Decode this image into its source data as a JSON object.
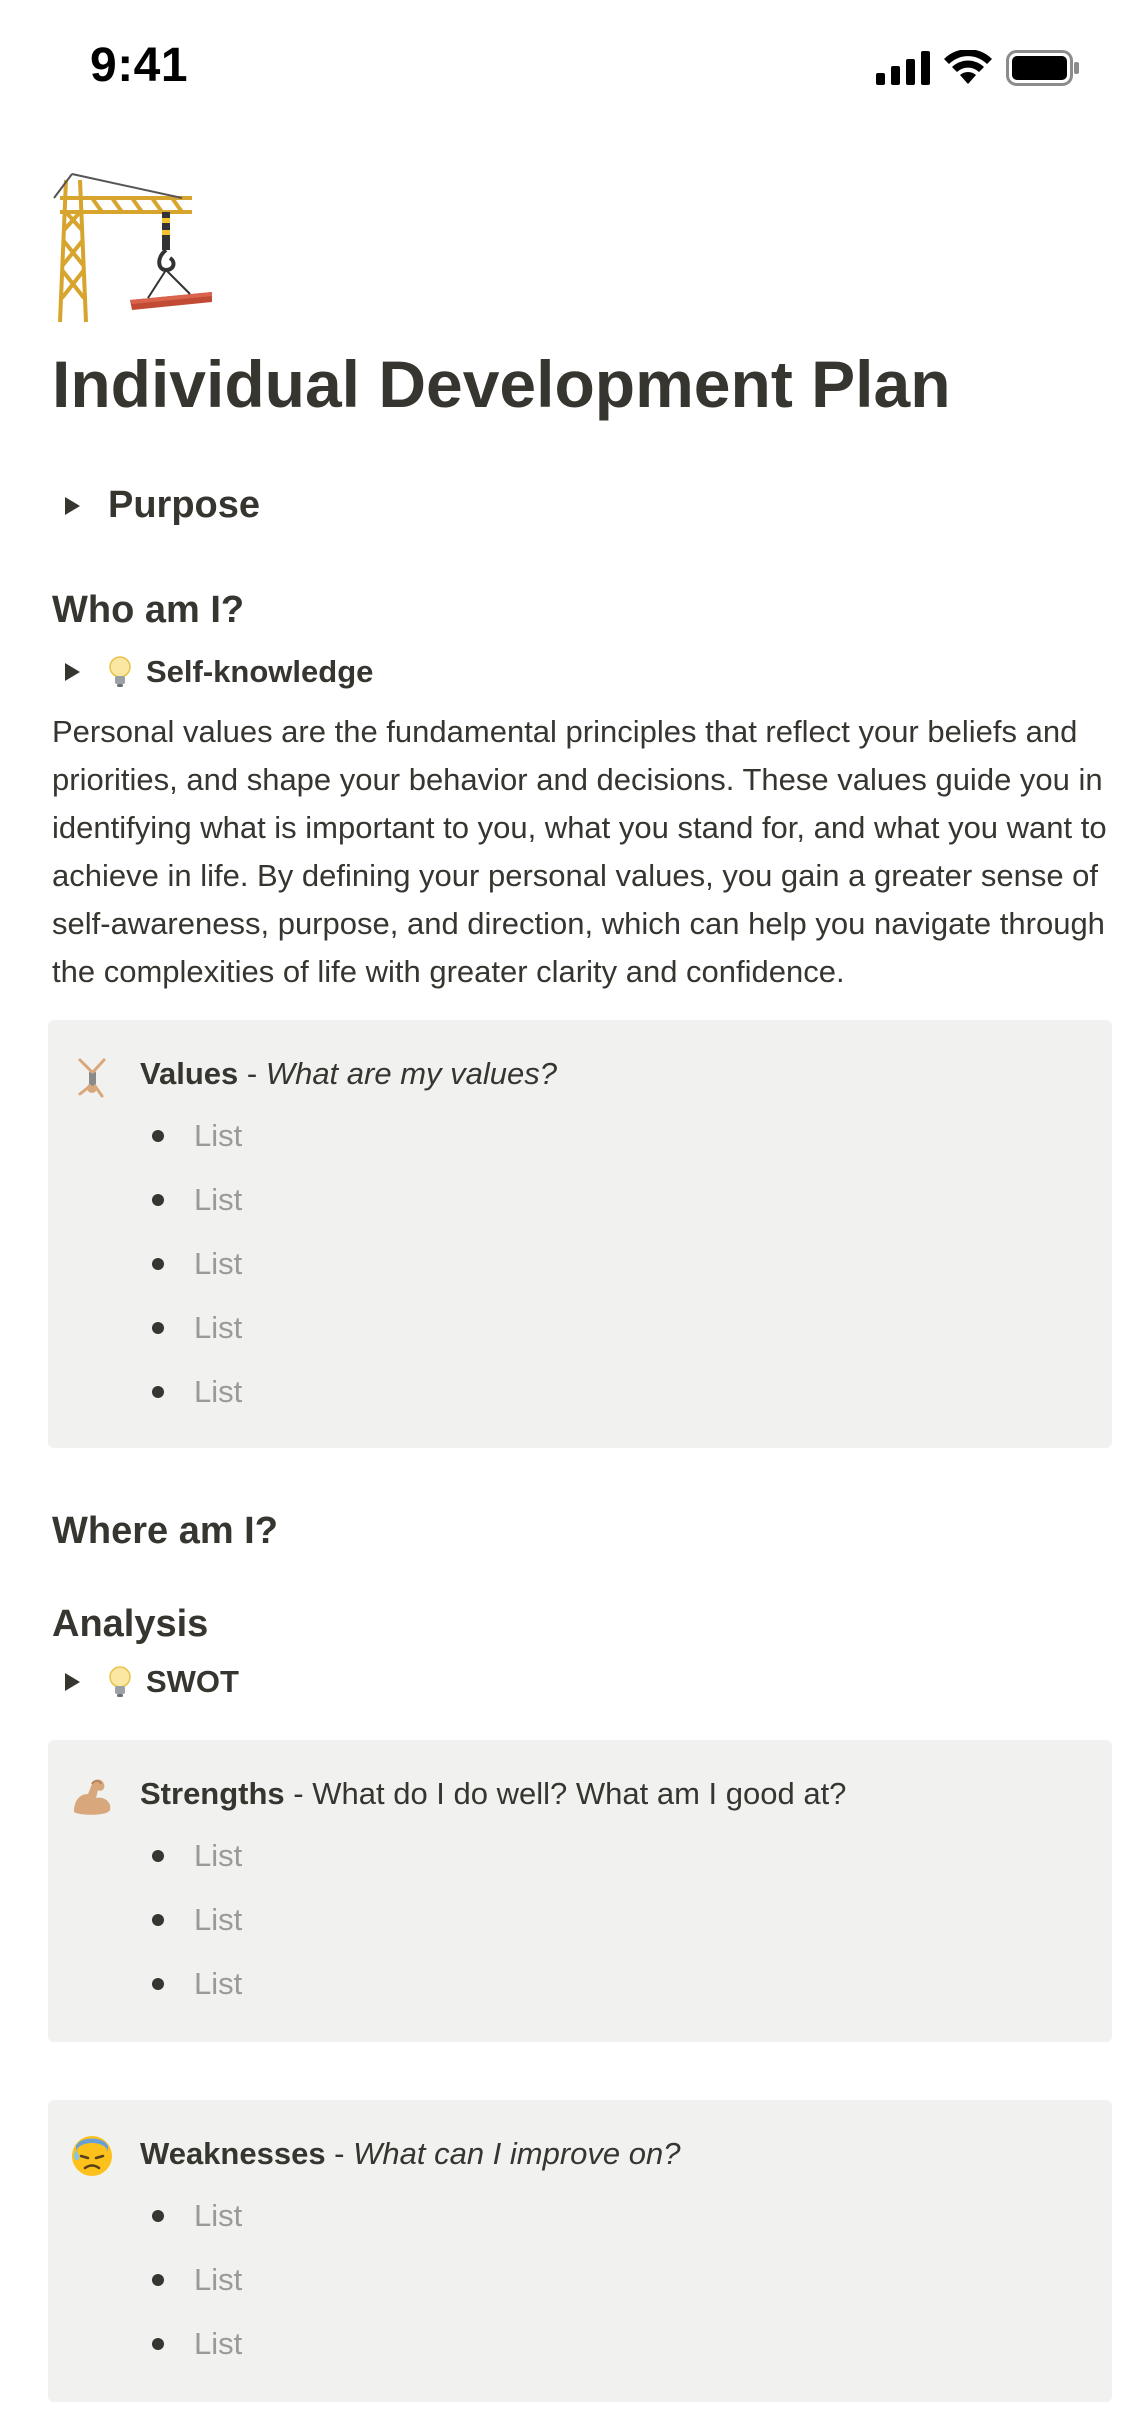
{
  "status_bar": {
    "time": "9:41"
  },
  "page": {
    "icon": "construction-crane-icon",
    "title": "Individual Development Plan"
  },
  "purpose_toggle": {
    "label": "Purpose"
  },
  "who_section": {
    "heading": "Who am I?",
    "toggle_label": "Self-knowledge",
    "paragraph": "Personal values are the fundamental principles that reflect your beliefs and priorities, and shape your behavior and decisions. These values guide you in identifying what is important to you, what you stand for, and what you want to achieve in life. By defining your personal values, you gain a greater sense of self-awareness, purpose, and direction, which can help you navigate through the complexities of life with greater clarity and confidence."
  },
  "values_callout": {
    "icon": "cartwheel-person-icon",
    "title": "Values",
    "separator": " - ",
    "subtitle": "What are my values?",
    "items": [
      "List",
      "List",
      "List",
      "List",
      "List"
    ]
  },
  "where_section": {
    "heading": "Where am I?",
    "subheading": "Analysis",
    "toggle_label": "SWOT"
  },
  "strengths_callout": {
    "icon": "flexed-biceps-icon",
    "title": "Strengths",
    "separator": " - ",
    "subtitle": "What do I do well? What am I good at?",
    "items": [
      "List",
      "List",
      "List"
    ]
  },
  "weaknesses_callout": {
    "icon": "anxious-sweat-face-icon",
    "title": "Weaknesses",
    "separator": " - ",
    "subtitle": "What can I improve on?",
    "items": [
      "List",
      "List",
      "List"
    ]
  },
  "colors": {
    "text": "#37352f",
    "muted": "#9b9a97",
    "callout_bg": "#f1f1ef"
  }
}
